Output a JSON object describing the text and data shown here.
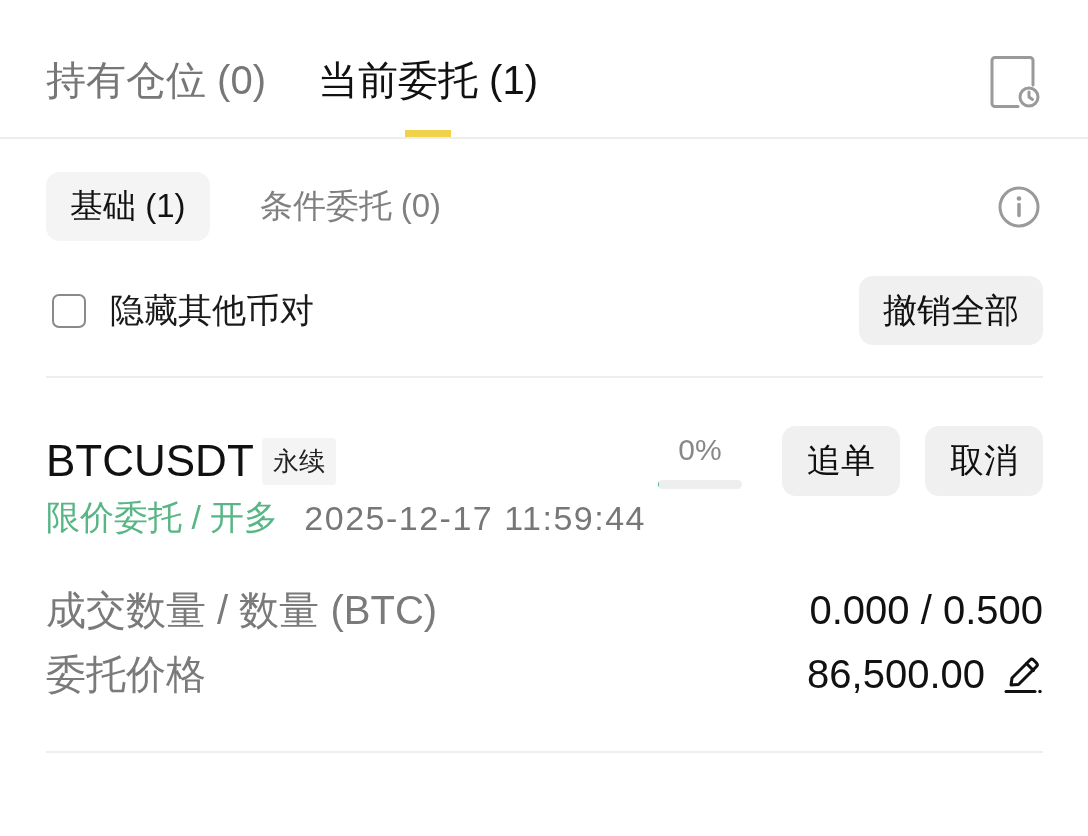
{
  "tabs": [
    {
      "label": "持有仓位 (0)",
      "selected": false
    },
    {
      "label": "当前委托 (1)",
      "selected": true
    }
  ],
  "subtabs": [
    {
      "label": "基础 (1)",
      "selected": true
    },
    {
      "label": "条件委托 (0)",
      "selected": false
    }
  ],
  "filter": {
    "label": "隐藏其他币对",
    "checked": false
  },
  "cancel_all_button": "撤销全部",
  "orders": [
    {
      "symbol": "BTCUSDT",
      "tag": "永续",
      "type_side": "限价委托 / 开多",
      "time": "2025-12-17 11:59:44",
      "fill_percent": "0%",
      "level": 0,
      "buttons": [
        "追单",
        "取消"
      ],
      "fields": [
        {
          "label": "成交数量 / 数量 (BTC)",
          "value": "0.000 / 0.500",
          "editable": false
        },
        {
          "label": "委托价格",
          "value": "86,500.00",
          "editable": true
        }
      ]
    }
  ]
}
